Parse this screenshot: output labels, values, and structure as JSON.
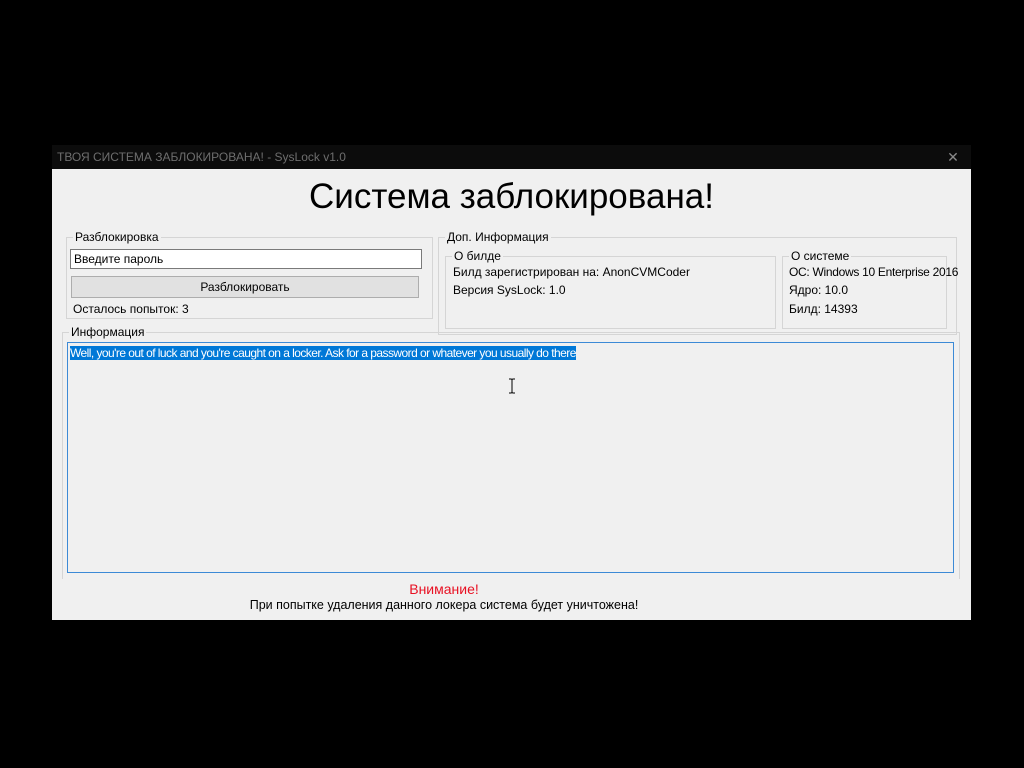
{
  "window": {
    "title": "ТВОЯ СИСТЕМА ЗАБЛОКИРОВАНА! - SysLock v1.0",
    "close_glyph": "✕",
    "headline": "Система заблокирована!"
  },
  "unlock": {
    "group_label": "Разблокировка",
    "password_value": "Введите пароль",
    "button_label": "Разблокировать",
    "attempts_text": "Осталось попыток: 3"
  },
  "extra_info": {
    "group_label": "Доп. Информация",
    "build": {
      "group_label": "О билде",
      "registered_to": "Билд зарегистрирован на: AnonCVMCoder",
      "version": "Версия SysLock: 1.0"
    },
    "system": {
      "group_label": "О системе",
      "os": "ОС: Windows 10 Enterprise 2016",
      "kernel": "Ядро: 10.0",
      "build": "Билд: 14393"
    }
  },
  "info": {
    "group_label": "Информация",
    "text": "Well, you're out of luck and you're caught on a locker. Ask for a password or whatever you usually do there"
  },
  "warning": {
    "title": "Внимание!",
    "text": "При попытке удаления данного локера система будет уничтожена!"
  },
  "colors": {
    "warning": "#e81123",
    "selection": "#0078d7",
    "titlebar": "#0c0c0c",
    "window_bg": "#f0f0f0"
  },
  "icons": {
    "close": "close-icon",
    "cursor": "text-cursor-icon"
  }
}
